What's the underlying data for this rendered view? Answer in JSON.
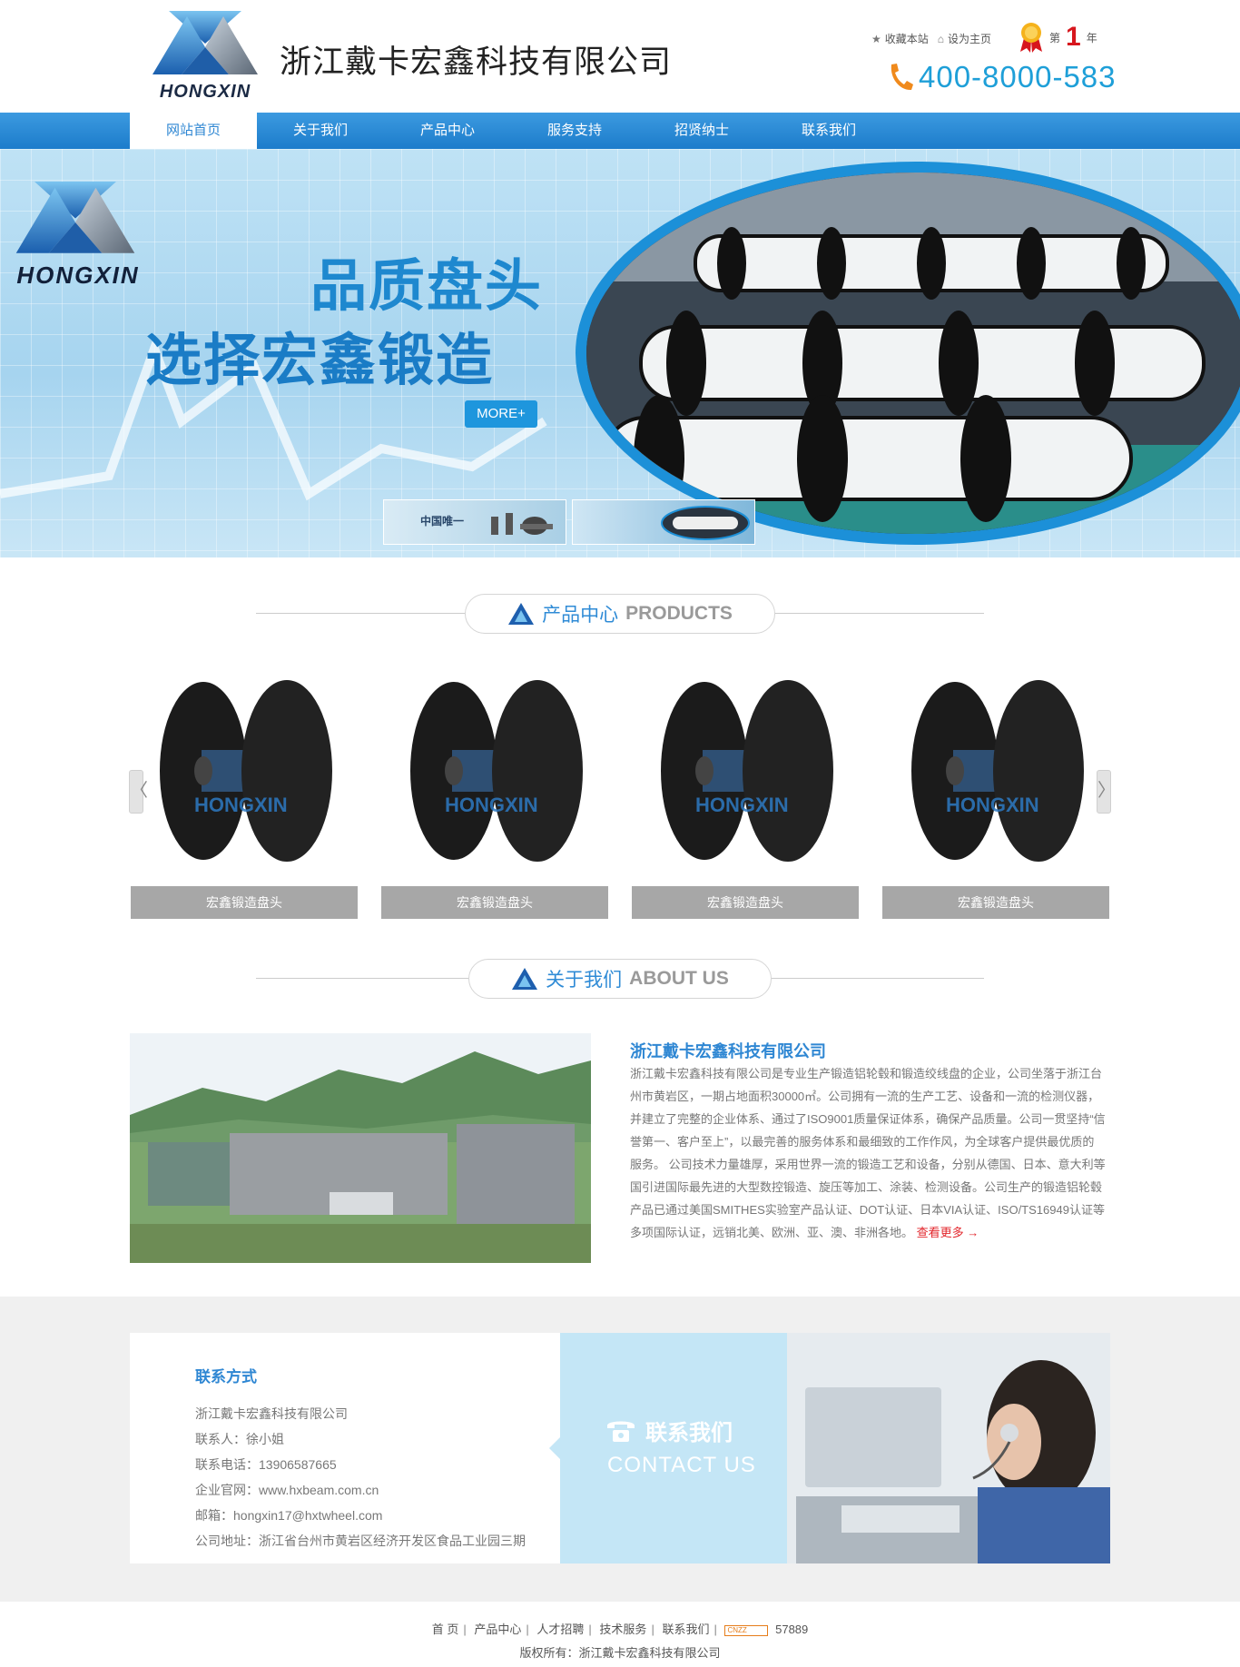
{
  "header": {
    "logo_text": "HONGXIN",
    "company_name": "浙江戴卡宏鑫科技有限公司",
    "favorite_label": "收藏本站",
    "homepage_label": "设为主页",
    "rank_prefix": "第",
    "rank_number": "1",
    "rank_suffix": "年",
    "hotline": "400-8000-583"
  },
  "nav": {
    "items": [
      {
        "label": "网站首页",
        "active": true
      },
      {
        "label": "关于我们"
      },
      {
        "label": "产品中心"
      },
      {
        "label": "服务支持"
      },
      {
        "label": "招贤纳士"
      },
      {
        "label": "联系我们"
      }
    ]
  },
  "banner": {
    "logo_text": "HONGXIN",
    "slogan_line1": "品质盘头",
    "slogan_line2": "选择宏鑫锻造",
    "more_label": "MORE+",
    "thumb1_label": "中国唯一"
  },
  "products": {
    "title_zh": "产品中心",
    "title_en": "PRODUCTS",
    "items": [
      {
        "caption": "宏鑫锻造盘头",
        "watermark": "HONGXIN"
      },
      {
        "caption": "宏鑫锻造盘头",
        "watermark": "HONGXIN"
      },
      {
        "caption": "宏鑫锻造盘头",
        "watermark": "HONGXIN"
      },
      {
        "caption": "宏鑫锻造盘头",
        "watermark": "HONGXIN"
      }
    ],
    "prev_glyph": "〈",
    "next_glyph": "〉"
  },
  "about": {
    "title_zh": "关于我们",
    "title_en": "ABOUT US",
    "company": "浙江戴卡宏鑫科技有限公司",
    "text": "浙江戴卡宏鑫科技有限公司是专业生产锻造铝轮毂和锻造绞线盘的企业，公司坐落于浙江台州市黄岩区，一期占地面积30000㎡。公司拥有一流的生产工艺、设备和一流的检测仪器，并建立了完整的企业体系、通过了ISO9001质量保证体系，确保产品质量。公司一贯坚持“信誉第一、客户至上”，以最完善的服务体系和最细致的工作作风，为全球客户提供最优质的服务。 公司技术力量雄厚，采用世界一流的锻造工艺和设备，分别从德国、日本、意大利等国引进国际最先进的大型数控锻造、旋压等加工、涂装、检测设备。公司生产的锻造铝轮毂产品已通过美国SMITHES实验室产品认证、DOT认证、日本VIA认证、ISO/TS16949认证等多项国际认证，远销北美、欧洲、亚、澳、非洲各地。",
    "more_label": "查看更多 →"
  },
  "contact": {
    "title": "联系方式",
    "lines": [
      "浙江戴卡宏鑫科技有限公司",
      "联系人：徐小姐",
      "联系电话：13906587665",
      "企业官网：www.hxbeam.com.cn",
      "邮箱：hongxin17@hxtwheel.com",
      "公司地址：浙江省台州市黄岩区经济开发区食品工业园三期"
    ],
    "cta_zh": "联系我们",
    "cta_en": "CONTACT US"
  },
  "footer": {
    "links": [
      "首 页",
      "产品中心",
      "人才招聘",
      "技术服务",
      "联系我们"
    ],
    "cnzz_label": "CNZZ",
    "counter": "57889",
    "copyright": "版权所有：浙江戴卡宏鑫科技有限公司"
  },
  "colors": {
    "brand_blue": "#2f87d3",
    "nav_blue": "#1c7ccb",
    "accent_red": "#e2252b",
    "hotline_blue": "#1e9fd8"
  }
}
